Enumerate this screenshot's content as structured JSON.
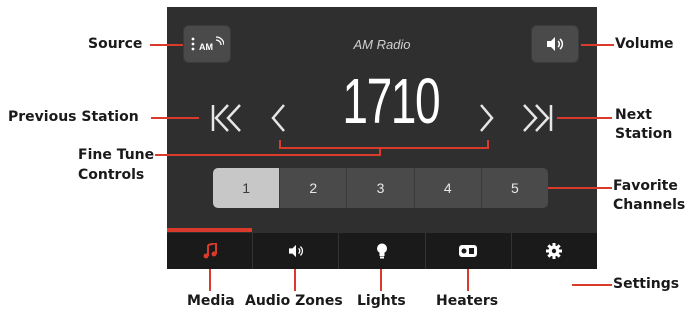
{
  "radio": {
    "title": "AM Radio",
    "frequency": "1710",
    "source_badge": "AM"
  },
  "favorites": [
    {
      "label": "1",
      "active": true
    },
    {
      "label": "2",
      "active": false
    },
    {
      "label": "3",
      "active": false
    },
    {
      "label": "4",
      "active": false
    },
    {
      "label": "5",
      "active": false
    }
  ],
  "tabs": [
    {
      "name": "media",
      "icon": "music-note-icon",
      "active": true
    },
    {
      "name": "audio-zones",
      "icon": "speaker-icon",
      "active": false
    },
    {
      "name": "lights",
      "icon": "bulb-icon",
      "active": false
    },
    {
      "name": "heaters",
      "icon": "heater-icon",
      "active": false
    },
    {
      "name": "settings",
      "icon": "gear-icon",
      "active": false
    }
  ],
  "callouts": {
    "source": "Source",
    "previous_station": "Previous Station",
    "fine_tune_1": "Fine Tune",
    "fine_tune_2": "Controls",
    "volume": "Volume",
    "next_1": "Next",
    "next_2": "Station",
    "favorite_1": "Favorite",
    "favorite_2": "Channels",
    "settings": "Settings",
    "media": "Media",
    "audio_zones": "Audio Zones",
    "lights": "Lights",
    "heaters": "Heaters"
  },
  "colors": {
    "accent": "#d93a2b",
    "screen_bg": "#2f2f2f",
    "tabbar_bg": "#1a1a1a"
  }
}
